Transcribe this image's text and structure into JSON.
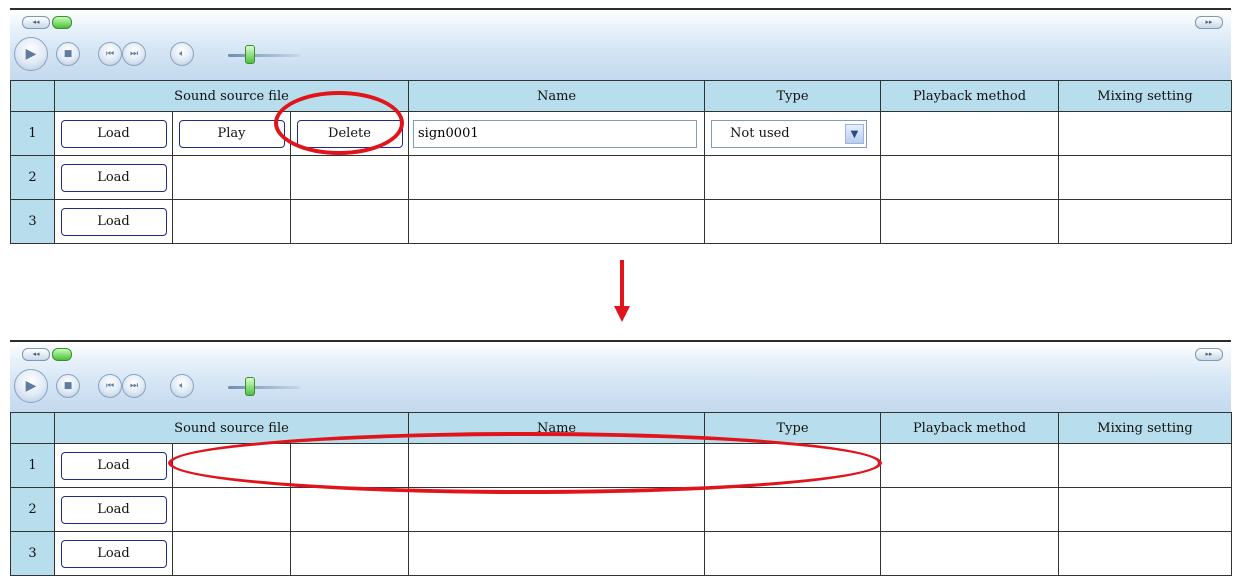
{
  "player": {
    "mini_left": "◂◂",
    "mini_right": "▸▸",
    "play_icon": "play-icon",
    "stop_icon": "stop-icon",
    "prev_icon": "previous-icon",
    "next_icon": "next-icon",
    "mute_icon": "volume-icon"
  },
  "table": {
    "headers": {
      "sound_source_file": "Sound source file",
      "name": "Name",
      "type": "Type",
      "playback_method": "Playback method",
      "mixing_setting": "Mixing setting"
    }
  },
  "before": {
    "rows": [
      {
        "num": "1",
        "load": "Load",
        "play": "Play",
        "delete": "Delete",
        "name_value": "sign0001",
        "type_value": "Not used"
      },
      {
        "num": "2",
        "load": "Load"
      },
      {
        "num": "3",
        "load": "Load"
      }
    ]
  },
  "after": {
    "rows": [
      {
        "num": "1",
        "load": "Load"
      },
      {
        "num": "2",
        "load": "Load"
      },
      {
        "num": "3",
        "load": "Load"
      }
    ]
  },
  "annotations": {
    "highlight_color": "#e0141a"
  }
}
